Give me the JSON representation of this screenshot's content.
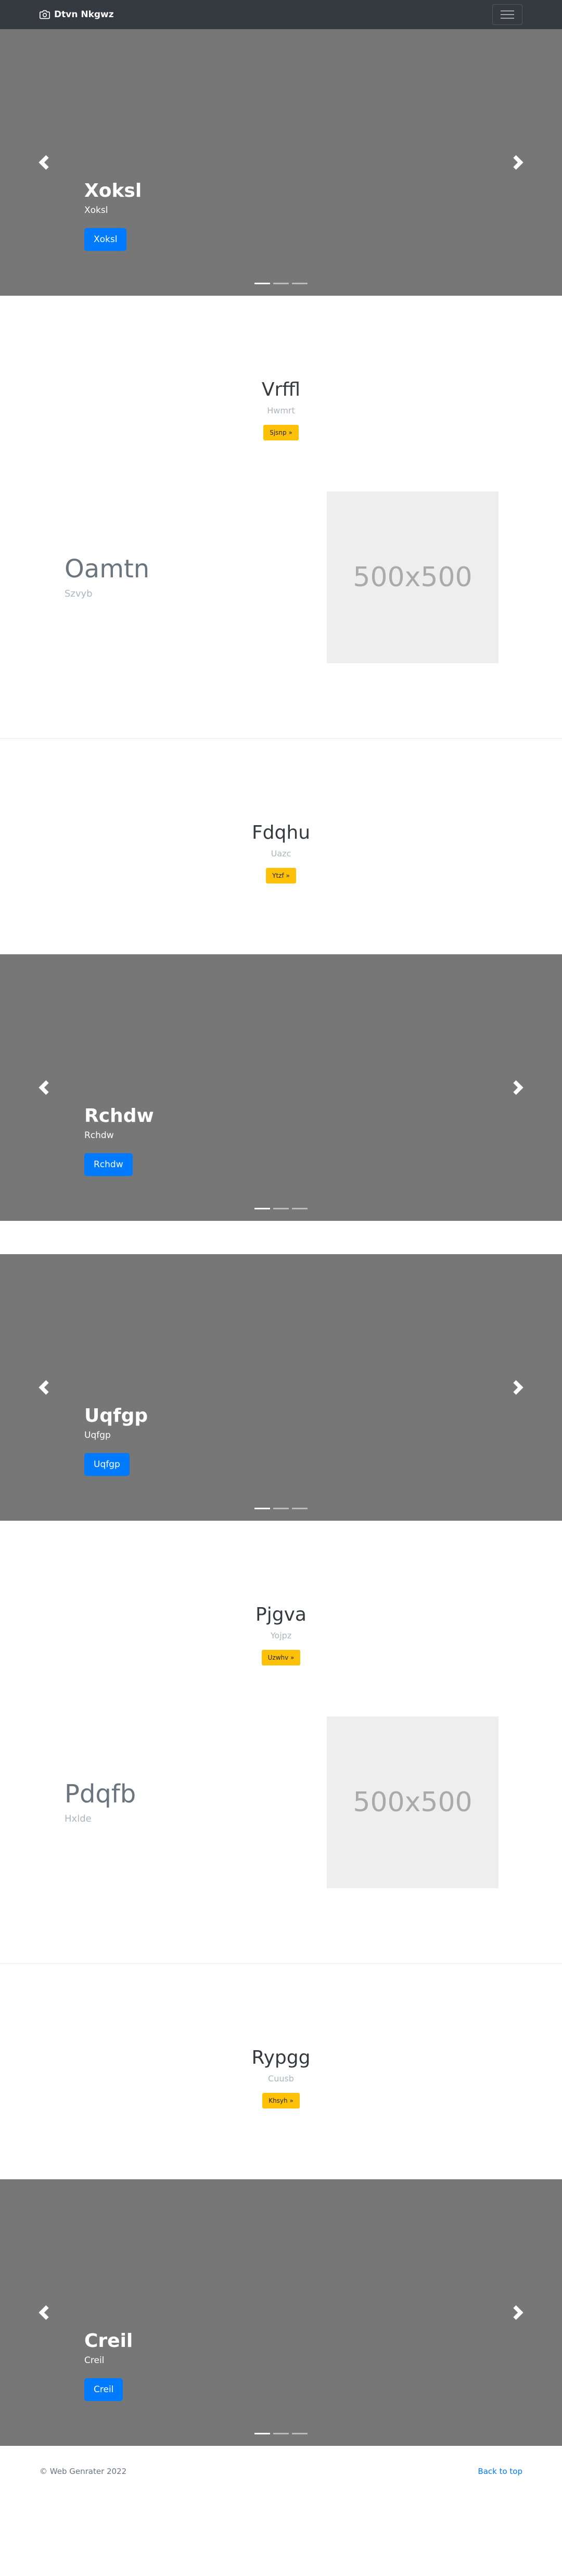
{
  "navbar": {
    "brand": "Dtvn Nkgwz",
    "brand_icon": "camera-icon",
    "toggler_icon": "hamburger-menu-icon"
  },
  "carousel1": {
    "title": "Xoksl",
    "text": "Xoksl",
    "button": "Xoksl"
  },
  "heading1": {
    "title": "Vrffl",
    "sub": "Hwmrt",
    "button": "Sjsnp »"
  },
  "feature1": {
    "title": "Oamtn",
    "sub": "Szvyb",
    "image": "500x500"
  },
  "heading2": {
    "title": "Fdqhu",
    "sub": "Uazc",
    "button": "Ytzf »"
  },
  "carousel2": {
    "title": "Rchdw",
    "text": "Rchdw",
    "button": "Rchdw"
  },
  "carousel3": {
    "title": "Uqfgp",
    "text": "Uqfgp",
    "button": "Uqfgp"
  },
  "heading3": {
    "title": "Pjgva",
    "sub": "Yojpz",
    "button": "Uzwhv »"
  },
  "feature2": {
    "title": "Pdqfb",
    "sub": "Hxlde",
    "image": "500x500"
  },
  "heading4": {
    "title": "Rypgg",
    "sub": "Cuusb",
    "button": "Khsyh »"
  },
  "carousel4": {
    "title": "Creil",
    "text": "Creil",
    "button": "Creil"
  },
  "footer": {
    "copyright": "© Web Genrater 2022",
    "back_to_top": "Back to top"
  },
  "colors": {
    "navbar": "#343a40",
    "carousel_bg": "#777777",
    "primary": "#007bff",
    "warning": "#ffc107",
    "placeholder_bg": "#eeeeee"
  }
}
